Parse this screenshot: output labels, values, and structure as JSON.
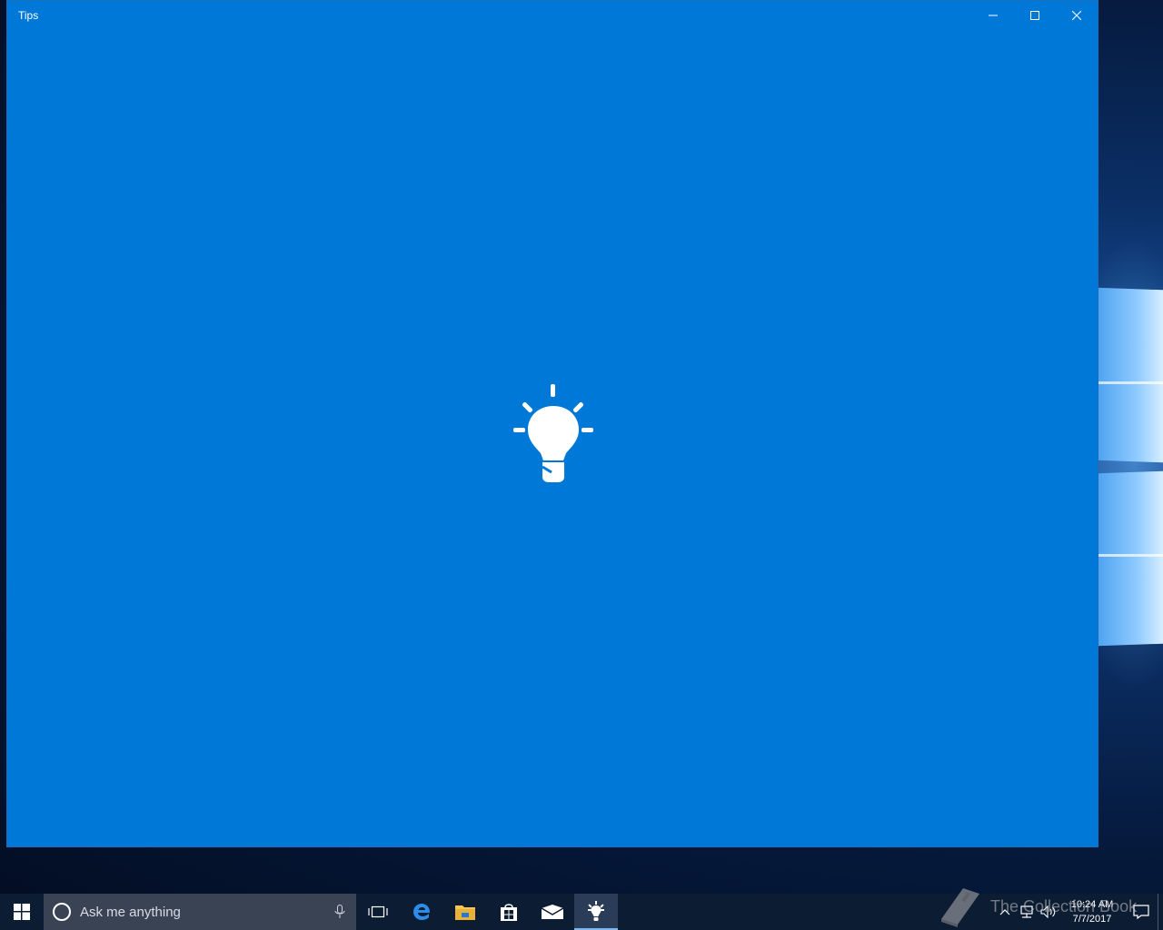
{
  "window": {
    "title": "Tips",
    "background": "#0078d7",
    "controls": [
      "minimize-icon",
      "maximize-icon",
      "close-icon"
    ]
  },
  "splash": {
    "icon": "lightbulb-icon"
  },
  "taskbar": {
    "search_placeholder": "Ask me anything",
    "pinned": [
      "task-view-icon",
      "edge-icon",
      "file-explorer-icon",
      "store-icon",
      "mail-icon",
      "tips-icon"
    ],
    "active_app": "tips-icon",
    "clock": {
      "time": "10:24 AM",
      "date": "7/7/2017"
    }
  },
  "watermark": {
    "text": "The Collection Book"
  }
}
